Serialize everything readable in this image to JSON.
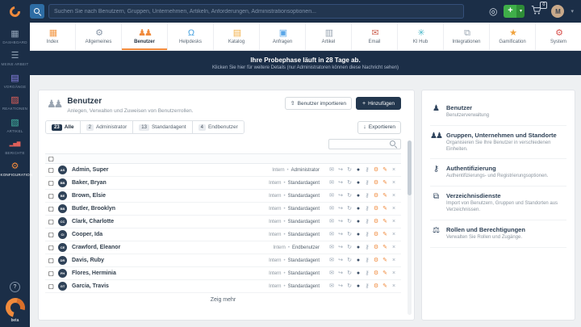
{
  "colors": {
    "navy": "#1b2e47",
    "orange": "#f08a3c",
    "green": "#3fae49",
    "background": "#eef0f2"
  },
  "topbar": {
    "search_placeholder": "Suchen Sie nach Benutzern, Gruppen, Unternehmen, Artikeln, Anforderungen, Administrationsoptionen...",
    "target_glyph": "◎",
    "add_glyph": "+",
    "add_caret_glyph": "▾",
    "cart_badge": "0",
    "avatar_initial": "M",
    "menu_caret_glyph": "▾"
  },
  "sidebar": {
    "items": [
      {
        "label": "DASHBOARD",
        "icon": "dashboard-icon",
        "glyph": "▦",
        "color": "#8fa1b5"
      },
      {
        "label": "MEINE ARBEIT",
        "icon": "my-work-icon",
        "glyph": "☰",
        "color": "#8fa1b5"
      },
      {
        "label": "VORGÄNGE",
        "icon": "tickets-icon",
        "glyph": "▤",
        "color": "#8d84e8"
      },
      {
        "label": "REAKTIONEN",
        "icon": "reactions-icon",
        "glyph": "▨",
        "color": "#e0605a"
      },
      {
        "label": "ARTIKEL",
        "icon": "articles-icon",
        "glyph": "▧",
        "color": "#45b8a4"
      },
      {
        "label": "BERICHTE",
        "icon": "reports-icon",
        "glyph": "▂▅▇",
        "color": "#e0605a"
      },
      {
        "label": "KONFIGURATION",
        "icon": "configuration-icon",
        "glyph": "⚙",
        "color": "#f08a3c"
      }
    ],
    "help_glyph": "?",
    "beta_label": "beta"
  },
  "menu": {
    "items": [
      {
        "label": "Index",
        "icon": "grid-icon",
        "glyph": "▦",
        "color": "#f29a4a"
      },
      {
        "label": "Allgemeines",
        "icon": "gear-icon",
        "glyph": "⚙",
        "color": "#8a97a8"
      },
      {
        "label": "Benutzer",
        "icon": "users-icon",
        "glyph": "♟♟",
        "color": "#f08a3c"
      },
      {
        "label": "Helpdesks",
        "icon": "headset-icon",
        "glyph": "Ω",
        "color": "#4aa3e0"
      },
      {
        "label": "Katalog",
        "icon": "book-icon",
        "glyph": "▤",
        "color": "#f2b04a"
      },
      {
        "label": "Anfragen",
        "icon": "request-icon",
        "glyph": "▣",
        "color": "#5aa7e8"
      },
      {
        "label": "Artikel",
        "icon": "article-icon",
        "glyph": "▥",
        "color": "#9aa5b2"
      },
      {
        "label": "Email",
        "icon": "email-icon",
        "glyph": "✉",
        "color": "#cf6a5a"
      },
      {
        "label": "KI Hub",
        "icon": "ai-hub-icon",
        "glyph": "✳",
        "color": "#4ab8c9"
      },
      {
        "label": "Integrationen",
        "icon": "integrations-icon",
        "glyph": "⧉",
        "color": "#9aa5b2"
      },
      {
        "label": "Gamification",
        "icon": "trophy-icon",
        "glyph": "★",
        "color": "#f0a23c"
      },
      {
        "label": "System",
        "icon": "system-gear-icon",
        "glyph": "⚙",
        "color": "#d9534f"
      }
    ]
  },
  "banner": {
    "title": "Ihre Probephase läuft in 28 Tage ab.",
    "subtitle": "Klicken Sie hier für weitere Details (nur Administratoren können diese Nachricht sehen)"
  },
  "users_panel": {
    "title": "Benutzer",
    "subtitle": "Anlegen, Verwalten und Zuweisen von Benutzerrollen.",
    "title_icon_glyph": "♟♟",
    "import_label": "Benutzer importieren",
    "import_icon_glyph": "⇧",
    "add_label": "Hinzufügen",
    "add_icon_glyph": "+",
    "export_label": "Exportieren",
    "export_icon_glyph": "↓",
    "show_more_label": "Zeig mehr",
    "origin_label": "Intern",
    "dot": "•",
    "filters": [
      {
        "count": "23",
        "label": "Alle"
      },
      {
        "count": "2",
        "label": "Administrator"
      },
      {
        "count": "13",
        "label": "Standardagent"
      },
      {
        "count": "4",
        "label": "Endbenutzer"
      }
    ],
    "row_icons": [
      {
        "name": "mail-icon",
        "glyph": "✉",
        "color": "#9aa7b5"
      },
      {
        "name": "login-as-icon",
        "glyph": "↪",
        "color": "#9aa7b5"
      },
      {
        "name": "reset-password-icon",
        "glyph": "↻",
        "color": "#9aa7b5"
      },
      {
        "name": "permissions-icon",
        "glyph": "●",
        "color": "#3d5068"
      },
      {
        "name": "api-key-icon",
        "glyph": "⚷",
        "color": "#9aa7b5"
      },
      {
        "name": "settings-icon",
        "glyph": "⚙",
        "color": "#f08a3c"
      },
      {
        "name": "edit-icon",
        "glyph": "✎",
        "color": "#f08a3c"
      },
      {
        "name": "delete-icon",
        "glyph": "×",
        "color": "#9aa7b5"
      }
    ],
    "users": [
      {
        "initials": "AS",
        "name": "Admin, Super",
        "role": "Administrator"
      },
      {
        "initials": "BB",
        "name": "Baker, Bryan",
        "role": "Standardagent"
      },
      {
        "initials": "BE",
        "name": "Brown, Elsie",
        "role": "Standardagent"
      },
      {
        "initials": "BB",
        "name": "Butler, Brooklyn",
        "role": "Standardagent"
      },
      {
        "initials": "CC",
        "name": "Clark, Charlotte",
        "role": "Standardagent"
      },
      {
        "initials": "CI",
        "name": "Cooper, Ida",
        "role": "Standardagent"
      },
      {
        "initials": "CE",
        "name": "Crawford, Eleanor",
        "role": "Endbenutzer"
      },
      {
        "initials": "DR",
        "name": "Davis, Ruby",
        "role": "Standardagent"
      },
      {
        "initials": "FH",
        "name": "Flores, Herminia",
        "role": "Standardagent"
      },
      {
        "initials": "GT",
        "name": "Garcia, Travis",
        "role": "Standardagent"
      }
    ]
  },
  "side_panel": {
    "items": [
      {
        "title": "Benutzer",
        "subtitle": "Benutzerverwaltung",
        "icon": "user-icon",
        "glyph": "♟"
      },
      {
        "title": "Gruppen, Unternehmen und Standorte",
        "subtitle": "Organisieren Sie Ihre Benutzer in verschiedenen Einheiten.",
        "icon": "groups-icon",
        "glyph": "♟♟"
      },
      {
        "title": "Authentifizierung",
        "subtitle": "Authentifizierungs- und Registrierungsoptionen.",
        "icon": "auth-icon",
        "glyph": "⚷"
      },
      {
        "title": "Verzeichnisdienste",
        "subtitle": "Import von Benutzern, Gruppen und Standorten aus Verzeichnissen.",
        "icon": "directory-icon",
        "glyph": "⧉"
      },
      {
        "title": "Rollen und Berechtigungen",
        "subtitle": "Verwalten Sie Rollen und Zugänge.",
        "icon": "roles-icon",
        "glyph": "⚖"
      }
    ]
  }
}
